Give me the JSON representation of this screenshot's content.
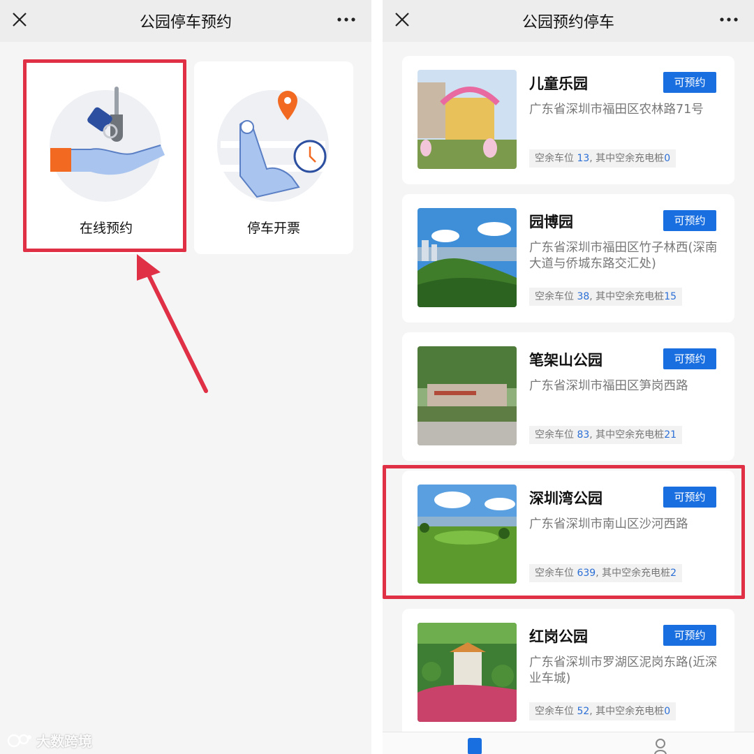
{
  "left_screen": {
    "title": "公园停车预约",
    "menu": [
      {
        "label": "在线预约",
        "icon": "hand-with-keys-icon"
      },
      {
        "label": "停车开票",
        "icon": "finger-pin-clock-icon"
      }
    ]
  },
  "right_screen": {
    "title": "公园预约停车",
    "parks": [
      {
        "name": "儿童乐园",
        "badge": "可预约",
        "address": "广东省深圳市福田区农林路71号",
        "stat_prefix": "空余车位",
        "spaces": "13",
        "stat_mid": ", 其中空余充电桩",
        "chargers": "0"
      },
      {
        "name": "园博园",
        "badge": "可预约",
        "address": "广东省深圳市福田区竹子林西(深南大道与侨城东路交汇处)",
        "stat_prefix": "空余车位",
        "spaces": "38",
        "stat_mid": ", 其中空余充电桩",
        "chargers": "15"
      },
      {
        "name": "笔架山公园",
        "badge": "可预约",
        "address": "广东省深圳市福田区笋岗西路",
        "stat_prefix": "空余车位",
        "spaces": "83",
        "stat_mid": ", 其中空余充电桩",
        "chargers": "21"
      },
      {
        "name": "深圳湾公园",
        "badge": "可预约",
        "address": "广东省深圳市南山区沙河西路",
        "stat_prefix": "空余车位",
        "spaces": "639",
        "stat_mid": ", 其中空余充电桩",
        "chargers": "2"
      },
      {
        "name": "红岗公园",
        "badge": "可预约",
        "address": "广东省深圳市罗湖区泥岗东路(近深业车城)",
        "stat_prefix": "空余车位",
        "spaces": "52",
        "stat_mid": ", 其中空余充电桩",
        "chargers": "0"
      }
    ]
  },
  "watermark": "大数跨境",
  "colors": {
    "highlight": "#e03046",
    "badge": "#1a6fe0",
    "number": "#2b6fd6"
  }
}
